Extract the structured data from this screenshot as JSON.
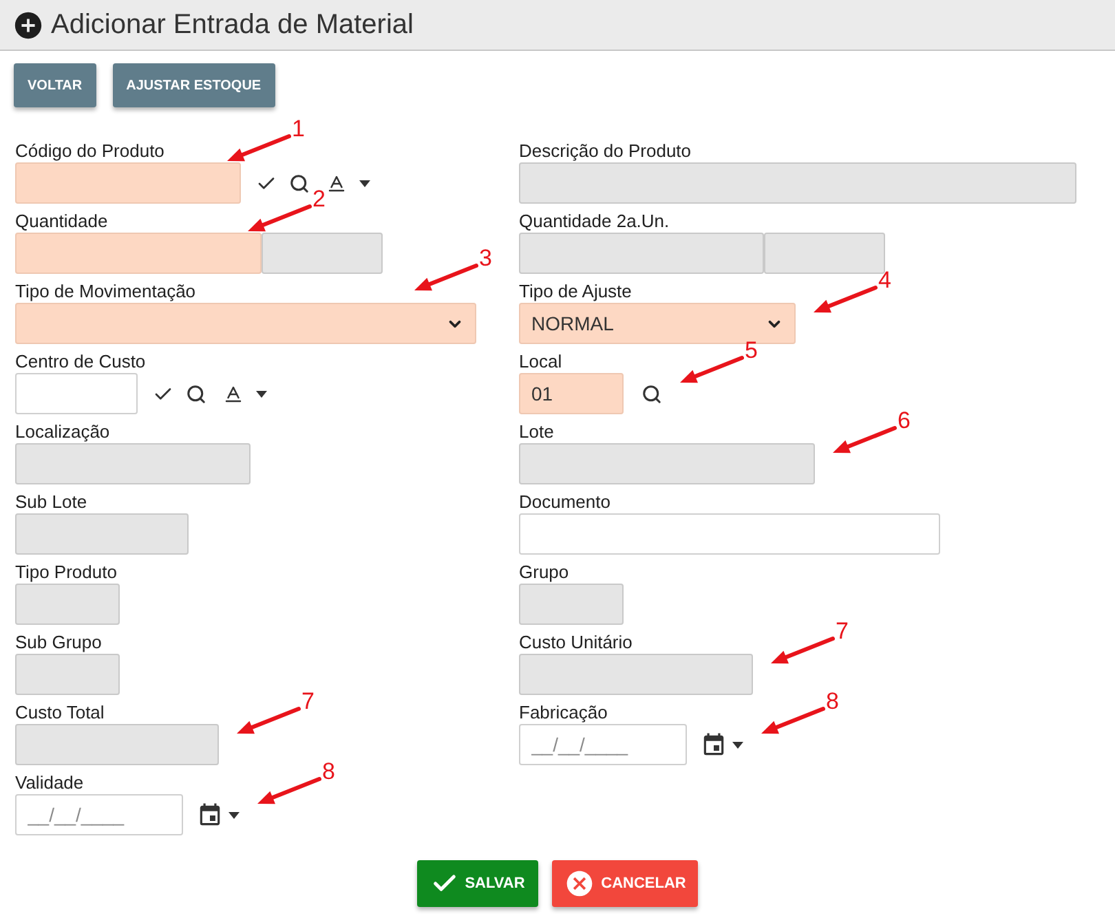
{
  "header": {
    "title": "Adicionar Entrada de Material"
  },
  "toolbar": {
    "buttons": [
      {
        "label": "VOLTAR"
      },
      {
        "label": "AJUSTAR ESTOQUE"
      }
    ]
  },
  "form": {
    "rows": [
      [
        {
          "kind": "lookup",
          "label": "Código do Produto",
          "required": true,
          "disabled": false,
          "annotation": {
            "number": "1",
            "kind": "corner"
          }
        },
        {
          "kind": "text",
          "label": "Descrição do Produto",
          "disabled": true
        }
      ],
      [
        {
          "kind": "split",
          "label": "Quantidade",
          "parts": [
            {
              "required": true,
              "disabled": false
            },
            {
              "disabled": true
            }
          ],
          "annotation": {
            "number": "2",
            "kind": "corner"
          }
        },
        {
          "kind": "split",
          "label": "Quantidade 2a.Un.",
          "parts": [
            {
              "disabled": true
            },
            {
              "disabled": true
            }
          ]
        }
      ],
      [
        {
          "kind": "select",
          "label": "Tipo de Movimentação",
          "required": true,
          "disabled": false,
          "annotation": {
            "number": "3",
            "kind": "top"
          }
        },
        {
          "kind": "select",
          "label": "Tipo de Ajuste",
          "value": "NORMAL",
          "required": true,
          "disabled": false,
          "annotation": {
            "number": "4",
            "kind": "side"
          }
        }
      ],
      [
        {
          "kind": "lookup",
          "label": "Centro de Custo",
          "required": false,
          "disabled": false
        },
        {
          "kind": "search",
          "label": "Local",
          "value": "01",
          "required": true,
          "disabled": false,
          "annotation": {
            "number": "5",
            "kind": "side"
          }
        }
      ],
      [
        {
          "kind": "text",
          "label": "Localização",
          "disabled": true
        },
        {
          "kind": "text",
          "label": "Lote",
          "disabled": true,
          "annotation": {
            "number": "6",
            "kind": "side"
          }
        }
      ],
      [
        {
          "kind": "text",
          "label": "Sub Lote",
          "disabled": true
        },
        {
          "kind": "text",
          "label": "Documento",
          "required": false,
          "disabled": false
        }
      ],
      [
        {
          "kind": "text",
          "label": "Tipo Produto",
          "disabled": true
        },
        {
          "kind": "text",
          "label": "Grupo",
          "disabled": true
        }
      ],
      [
        {
          "kind": "text",
          "label": "Sub Grupo",
          "disabled": true
        },
        {
          "kind": "text",
          "label": "Custo Unitário",
          "disabled": true,
          "annotation": {
            "number": "7",
            "kind": "side"
          }
        }
      ],
      [
        {
          "kind": "text",
          "label": "Custo Total",
          "disabled": true,
          "annotation": {
            "number": "7",
            "kind": "side"
          }
        },
        {
          "kind": "date",
          "label": "Fabricação",
          "placeholder": "__/__/____",
          "required": false,
          "disabled": false,
          "annotation": {
            "number": "8",
            "kind": "side"
          }
        }
      ],
      [
        {
          "kind": "date",
          "label": "Validade",
          "placeholder": "__/__/____",
          "required": false,
          "disabled": false,
          "annotation": {
            "number": "8",
            "kind": "side"
          }
        }
      ]
    ]
  },
  "actions": {
    "buttons": [
      {
        "kind": "save",
        "label": "SALVAR"
      },
      {
        "kind": "cancel",
        "label": "CANCELAR"
      }
    ]
  }
}
